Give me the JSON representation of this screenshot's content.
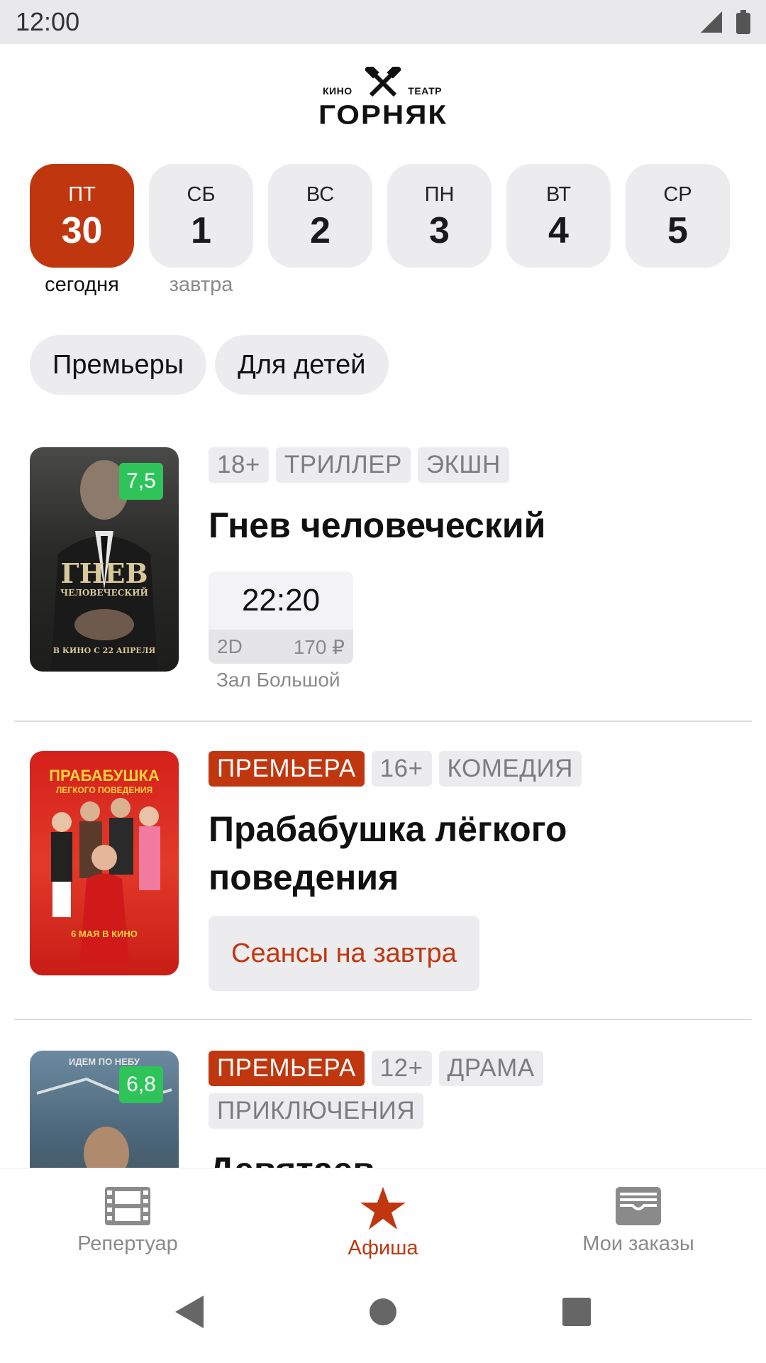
{
  "status_bar": {
    "time": "12:00"
  },
  "header": {
    "logo_small_left": "КИНО",
    "logo_small_right": "ТЕАТР",
    "logo_main": "ГОРНЯК"
  },
  "dates": [
    {
      "weekday": "ПТ",
      "day": "30",
      "caption": "сегодня",
      "selected": true
    },
    {
      "weekday": "СБ",
      "day": "1",
      "caption": "завтра",
      "selected": false
    },
    {
      "weekday": "ВС",
      "day": "2",
      "caption": "",
      "selected": false
    },
    {
      "weekday": "ПН",
      "day": "3",
      "caption": "",
      "selected": false
    },
    {
      "weekday": "ВТ",
      "day": "4",
      "caption": "",
      "selected": false
    },
    {
      "weekday": "СР",
      "day": "5",
      "caption": "",
      "selected": false
    }
  ],
  "filters": [
    "Премьеры",
    "Для детей"
  ],
  "movies": [
    {
      "rating": "7,5",
      "tags": [
        "18+",
        "ТРИЛЛЕР",
        "ЭКШН"
      ],
      "title": "Гнев человеческий",
      "poster_text": "ГНЕВ",
      "poster_sub": "ЧЕЛОВЕЧЕСКИЙ",
      "poster_bottom": "В КИНО С 22 АПРЕЛЯ",
      "session": {
        "time": "22:20",
        "format": "2D",
        "price": "170 ₽",
        "hall": "Зал Большой"
      }
    },
    {
      "premiere": "ПРЕМЬЕРА",
      "tags": [
        "16+",
        "КОМЕДИЯ"
      ],
      "title_line1": "Прабабушка лёгкого",
      "title_line2": "поведения",
      "poster_text": "ПРАБАБУШКА",
      "poster_sub": "ЛЕГКОГО ПОВЕДЕНИЯ",
      "poster_bottom": "6 МАЯ В КИНО",
      "button": "Сеансы на завтра"
    },
    {
      "rating": "6,8",
      "premiere": "ПРЕМЬЕРА",
      "tags": [
        "12+",
        "ДРАМА"
      ],
      "tags_row2": [
        "ПРИКЛЮЧЕНИЯ"
      ],
      "title": "Девятаев",
      "poster_text": "ИДЕМ ПО НЕБУ"
    }
  ],
  "bottom_nav": [
    {
      "label": "Репертуар",
      "icon": "film-icon",
      "active": false
    },
    {
      "label": "Афиша",
      "icon": "star-icon",
      "active": true
    },
    {
      "label": "Мои заказы",
      "icon": "wallet-icon",
      "active": false
    }
  ],
  "colors": {
    "accent": "#c0370f",
    "rating": "#2ec45a",
    "chip_bg": "#ececef"
  }
}
